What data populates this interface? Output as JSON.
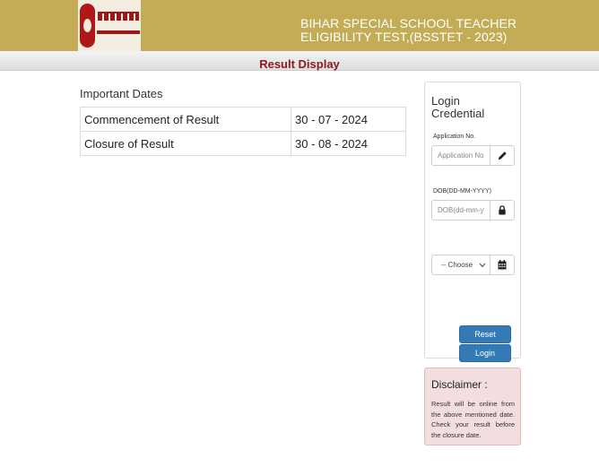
{
  "header": {
    "title_line1": "BIHAR SPECIAL SCHOOL TEACHER",
    "title_line2": "ELIGIBILITY TEST,(BSSTET - 2023)",
    "logo_text_hindi": "बिहार विद्यालय परीक्षा समिति",
    "logo_text_english": "BIHAR SCHOOL EXAMINATION BOARD"
  },
  "subheader": {
    "title": "Result Display"
  },
  "important_dates": {
    "heading": "Important Dates",
    "rows": [
      {
        "label": "Commencement of Result",
        "date": "30 - 07 - 2024"
      },
      {
        "label": "Closure of Result",
        "date": "30 - 08 - 2024"
      }
    ]
  },
  "login": {
    "title": "Login Credential",
    "application_label": "Application No.",
    "application_placeholder": "Application No.",
    "dob_label": "DOB(DD-MM-YYYY)",
    "dob_placeholder": "DOB(dd-mm-yyyy)",
    "select_value": "-- Choose",
    "reset_label": "Reset",
    "login_label": "Login",
    "icons": {
      "application": "pencil-icon",
      "dob": "lock-icon",
      "select": "calendar-icon"
    }
  },
  "disclaimer": {
    "title": "Disclaimer :",
    "text": "Result will be online from the above mentioned date. Check your result before the closure date."
  },
  "colors": {
    "header_bg": "#c4ab56",
    "accent_maroon": "#8b1c23",
    "button_blue": "#337ab7",
    "disclaimer_bg": "#f2dede"
  }
}
